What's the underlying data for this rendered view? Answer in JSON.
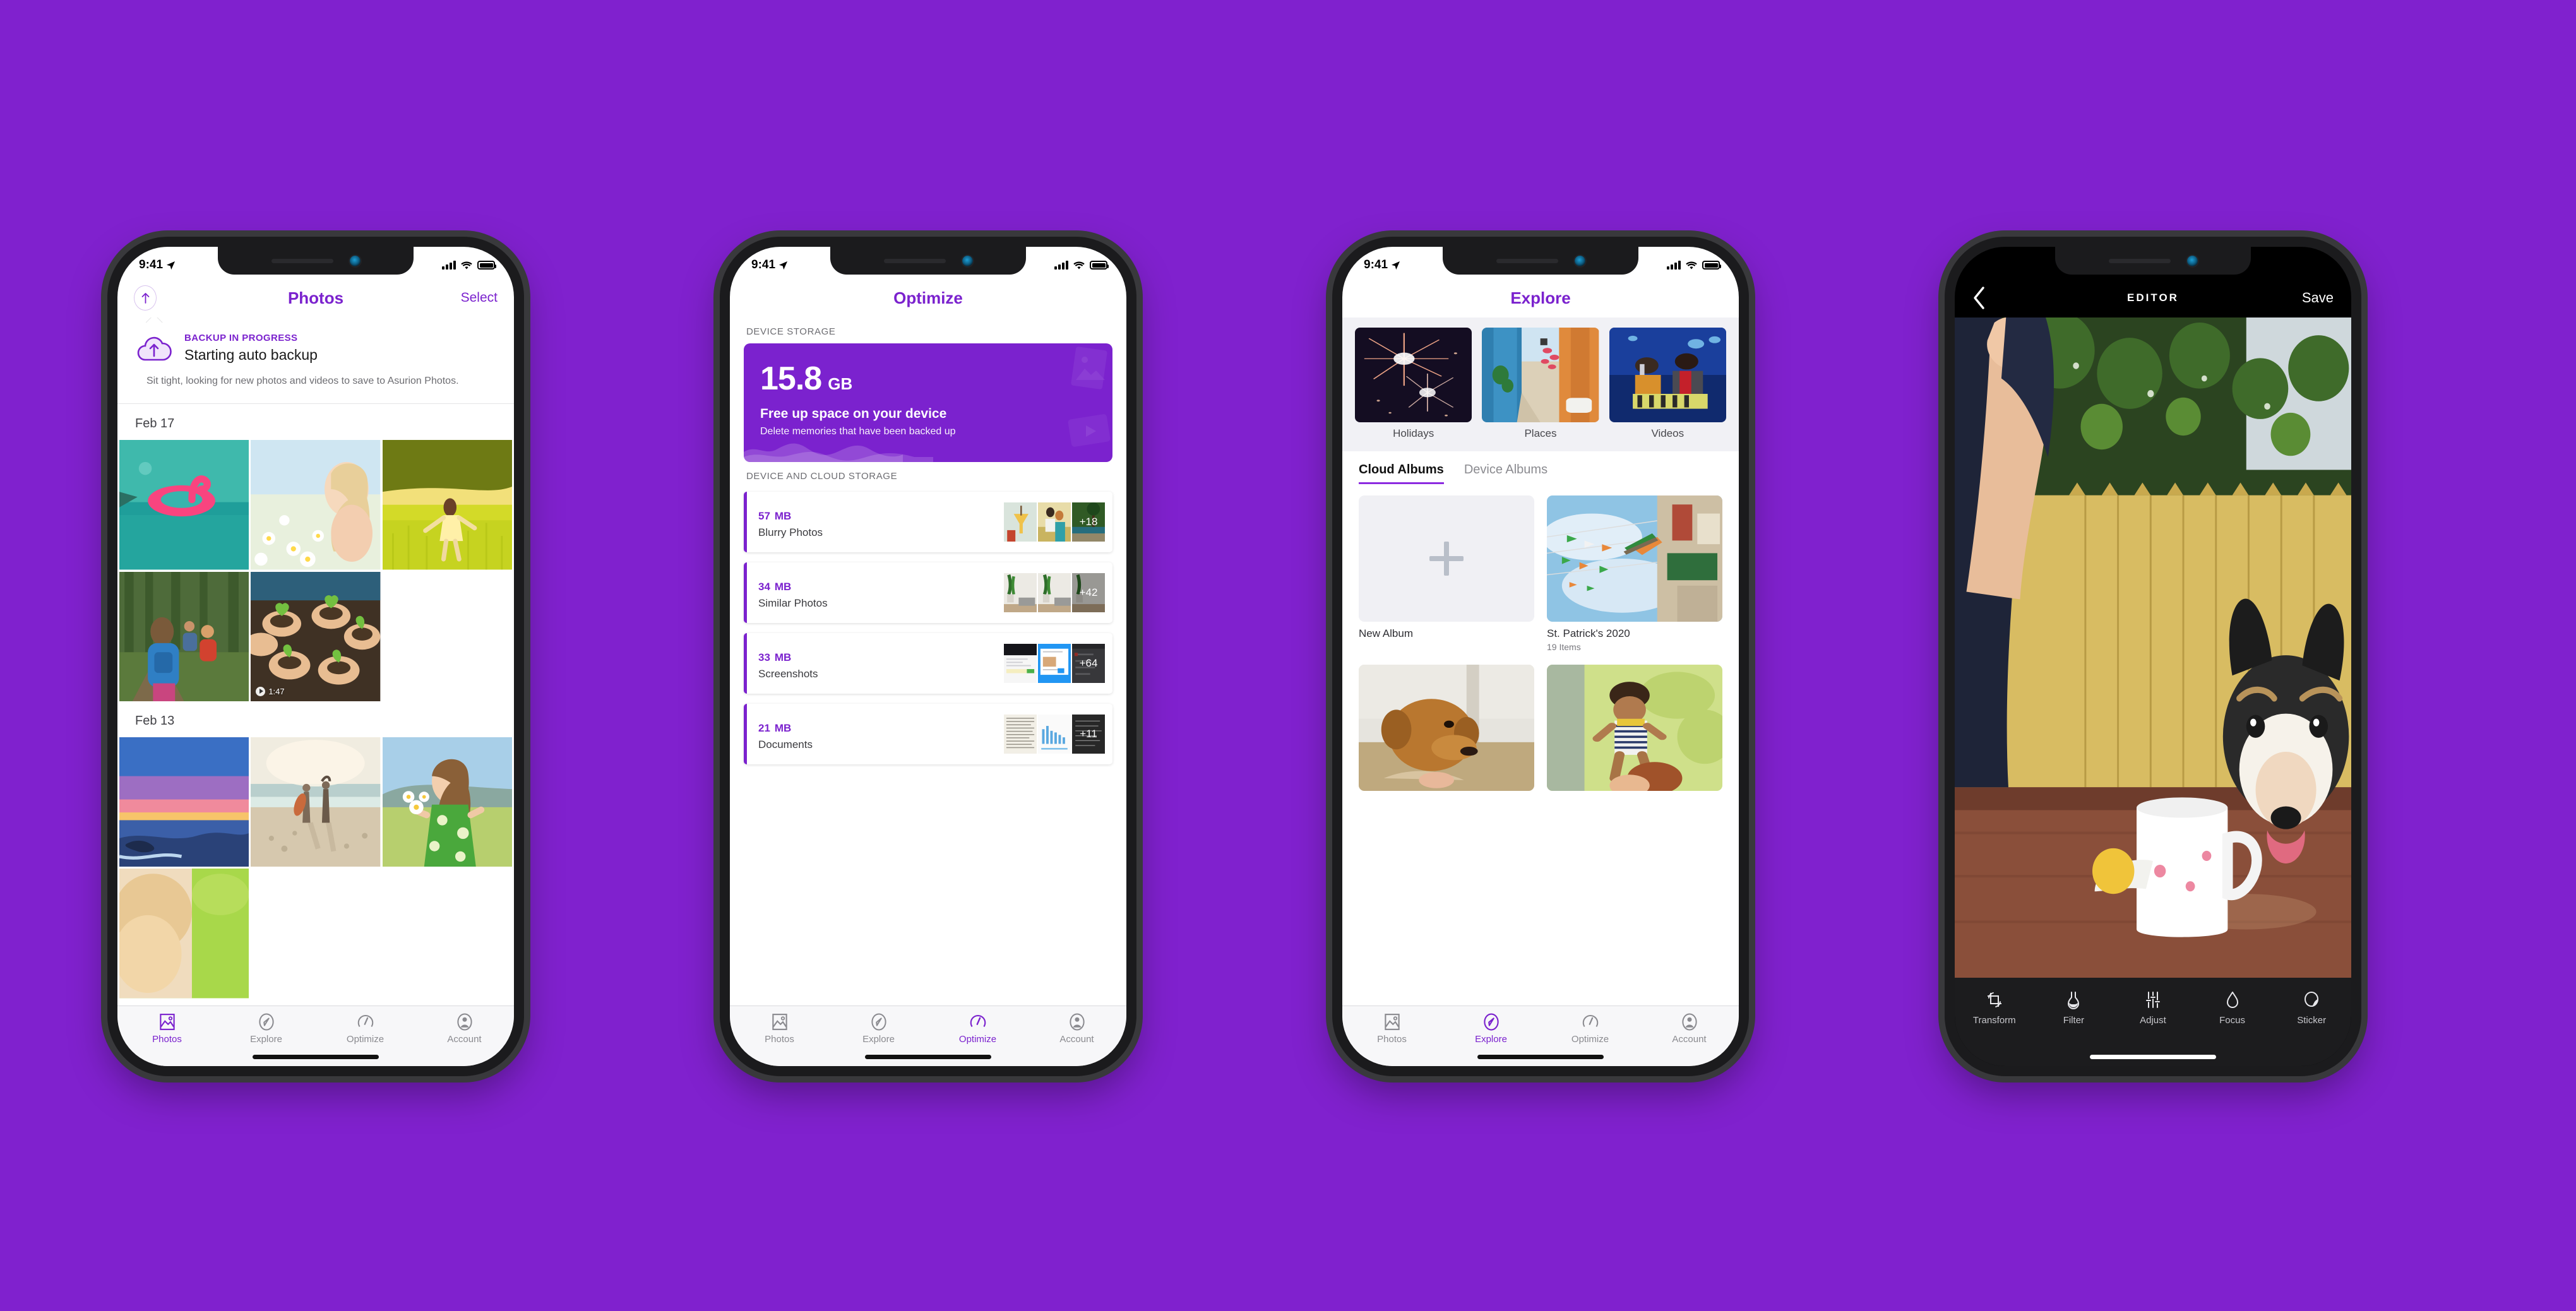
{
  "background_color": "#8021CE",
  "accent_purple": "#7B22CE",
  "status_bar": {
    "time": "9:41",
    "location_icon": "location-arrow-icon",
    "signal_icon": "cellular-bars-icon",
    "wifi_icon": "wifi-icon",
    "battery_icon": "battery-icon"
  },
  "phone1": {
    "nav": {
      "up_icon": "upload-circle-icon",
      "title": "Photos",
      "action": "Select"
    },
    "backup": {
      "icon": "cloud-upload-icon",
      "kicker": "BACKUP IN PROGRESS",
      "headline": "Starting auto backup",
      "description": "Sit tight, looking for new photos and videos to save to Asurion Photos."
    },
    "sections": [
      {
        "date": "Feb 17",
        "photos": [
          {
            "name": "flamingo-float-pool",
            "video": false
          },
          {
            "name": "woman-in-daisy-field",
            "video": false
          },
          {
            "name": "girl-running-in-grass",
            "video": false
          },
          {
            "name": "kid-hiking-forest-backpack",
            "video": false
          },
          {
            "name": "hands-holding-seedlings",
            "video": true,
            "duration": "1:47"
          }
        ]
      },
      {
        "date": "Feb 13",
        "photos": [
          {
            "name": "sunset-beach-pink-sky",
            "video": false
          },
          {
            "name": "surfers-walking-beach",
            "video": false
          },
          {
            "name": "girl-green-dress-daisies",
            "video": false
          },
          {
            "name": "blonde-child-grass",
            "video": false
          }
        ]
      }
    ],
    "tabs": [
      {
        "label": "Photos",
        "icon": "photo-icon",
        "active": true
      },
      {
        "label": "Explore",
        "icon": "compass-icon",
        "active": false
      },
      {
        "label": "Optimize",
        "icon": "speedometer-icon",
        "active": false
      },
      {
        "label": "Account",
        "icon": "account-icon",
        "active": false
      }
    ]
  },
  "phone2": {
    "nav": {
      "title": "Optimize"
    },
    "device_storage_label": "DEVICE STORAGE",
    "storage_card": {
      "amount": "15.8",
      "unit": "GB",
      "title": "Free up space on your device",
      "subtitle": "Delete memories that have been backed up"
    },
    "cloud_storage_label": "DEVICE AND CLOUD STORAGE",
    "rows": [
      {
        "size": "57",
        "unit": "MB",
        "name": "Blurry Photos",
        "more": "+18",
        "thumbs": [
          "cocktail-glass-blurry",
          "couple-in-field",
          "palm-trees-beach"
        ]
      },
      {
        "size": "34",
        "unit": "MB",
        "name": "Similar Photos",
        "more": "+42",
        "thumbs": [
          "living-room-plant-1",
          "living-room-plant-2",
          "living-room-plant-3"
        ]
      },
      {
        "size": "33",
        "unit": "MB",
        "name": "Screenshots",
        "more": "+64",
        "thumbs": [
          "terminal-screenshot",
          "web-app-screenshot",
          "gmail-screenshot"
        ]
      },
      {
        "size": "21",
        "unit": "MB",
        "name": "Documents",
        "more": "+11",
        "thumbs": [
          "book-page-text",
          "bar-chart-document",
          "handwriting-page"
        ]
      }
    ],
    "tabs": [
      {
        "label": "Photos",
        "icon": "photo-icon",
        "active": false
      },
      {
        "label": "Explore",
        "icon": "compass-icon",
        "active": false
      },
      {
        "label": "Optimize",
        "icon": "speedometer-icon",
        "active": true
      },
      {
        "label": "Account",
        "icon": "account-icon",
        "active": false
      }
    ]
  },
  "phone3": {
    "nav": {
      "title": "Explore"
    },
    "categories": [
      {
        "label": "Holidays",
        "image": "fireworks-night"
      },
      {
        "label": "Places",
        "image": "colorful-alley-street"
      },
      {
        "label": "Videos",
        "image": "concert-stage-performers"
      }
    ],
    "segments": [
      {
        "label": "Cloud Albums",
        "active": true
      },
      {
        "label": "Device Albums",
        "active": false
      }
    ],
    "albums": [
      {
        "name": "New Album",
        "count": "",
        "placeholder": "plus-icon"
      },
      {
        "name": "St. Patrick's 2020",
        "count": "19 Items",
        "image": "irish-pub-flags-bunting"
      },
      {
        "name": "",
        "count": "",
        "image": "golden-retriever-dog"
      },
      {
        "name": "",
        "count": "",
        "image": "toddler-lifted-by-mother"
      }
    ],
    "tabs": [
      {
        "label": "Photos",
        "icon": "photo-icon",
        "active": false
      },
      {
        "label": "Explore",
        "icon": "compass-icon",
        "active": true
      },
      {
        "label": "Optimize",
        "icon": "speedometer-icon",
        "active": false
      },
      {
        "label": "Account",
        "icon": "account-icon",
        "active": false
      }
    ]
  },
  "phone4": {
    "nav": {
      "back_icon": "chevron-left-icon",
      "title": "EDITOR",
      "save": "Save"
    },
    "photo": "man-arm-dog-mug-backyard-fence",
    "tools": [
      {
        "label": "Transform",
        "icon": "crop-rotate-icon"
      },
      {
        "label": "Filter",
        "icon": "filter-flask-icon"
      },
      {
        "label": "Adjust",
        "icon": "sliders-icon"
      },
      {
        "label": "Focus",
        "icon": "droplet-icon"
      },
      {
        "label": "Sticker",
        "icon": "sticker-icon"
      }
    ]
  }
}
